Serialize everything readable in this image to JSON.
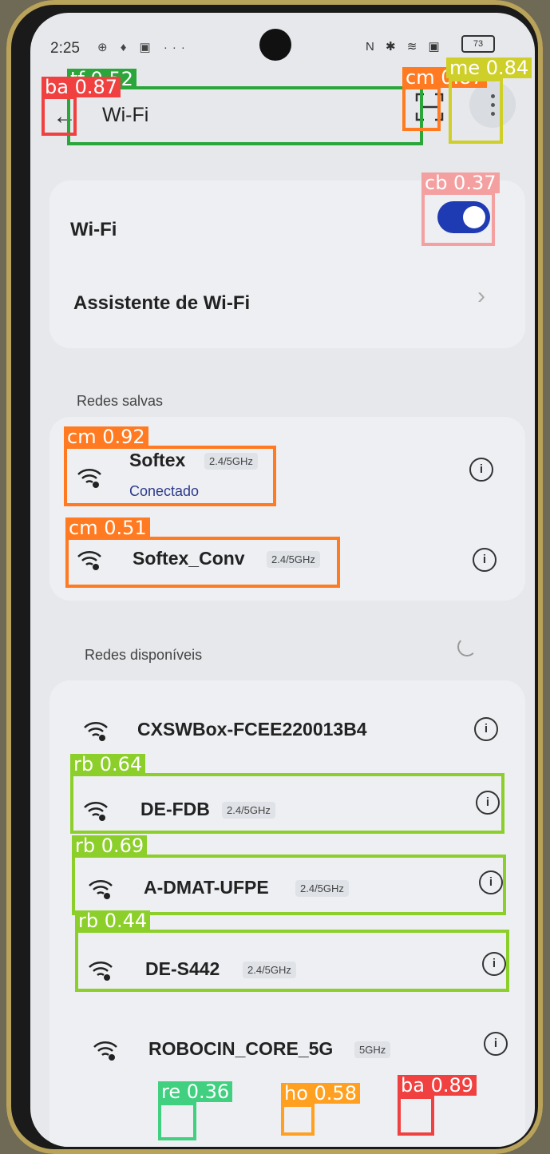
{
  "status": {
    "time": "2:25",
    "left_icons": "⊕ ♦ ▣ ···",
    "right_icons": "N ✱ ≋ ▣",
    "battery": "73"
  },
  "header": {
    "title": "Wi-Fi",
    "back_icon": "arrow-left-icon",
    "scan_icon": "qr-scan-icon",
    "more_icon": "more-vertical-icon"
  },
  "main": {
    "wifi_label": "Wi-Fi",
    "wifi_enabled": true,
    "assistant_label": "Assistente de Wi-Fi",
    "saved_section": "Redes salvas",
    "saved": [
      {
        "name": "Softex",
        "band": "2.4/5GHz",
        "status": "Conectado"
      },
      {
        "name": "Softex_Conv",
        "band": "2.4/5GHz"
      }
    ],
    "available_section": "Redes disponíveis",
    "available": [
      {
        "name": "CXSWBox-FCEE220013B4",
        "band": ""
      },
      {
        "name": "DE-FDB",
        "band": "2.4/5GHz"
      },
      {
        "name": "A-DMAT-UFPE",
        "band": "2.4/5GHz"
      },
      {
        "name": "DE-S442",
        "band": "2.4/5GHz"
      },
      {
        "name": "ROBOCIN_CORE_5G",
        "band": "5GHz"
      }
    ]
  },
  "overlays": [
    {
      "label": "tf 0.52",
      "color": "#2aa63a"
    },
    {
      "label": "ba 0.87",
      "color": "#f04040"
    },
    {
      "label": "cm 0.87",
      "color": "#ff7a20"
    },
    {
      "label": "me 0.84",
      "color": "#cfcf2a"
    },
    {
      "label": "cb 0.37",
      "color": "#f4a0a0"
    },
    {
      "label": "cm 0.92",
      "color": "#ff7a20"
    },
    {
      "label": "cm 0.51",
      "color": "#ff7a20"
    },
    {
      "label": "rb 0.64",
      "color": "#8ccf2a"
    },
    {
      "label": "rb 0.69",
      "color": "#8ccf2a"
    },
    {
      "label": "rb 0.44",
      "color": "#8ccf2a"
    },
    {
      "label": "re 0.36",
      "color": "#40d080"
    },
    {
      "label": "ho 0.58",
      "color": "#ffa020"
    },
    {
      "label": "ba 0.89",
      "color": "#f04040"
    }
  ]
}
